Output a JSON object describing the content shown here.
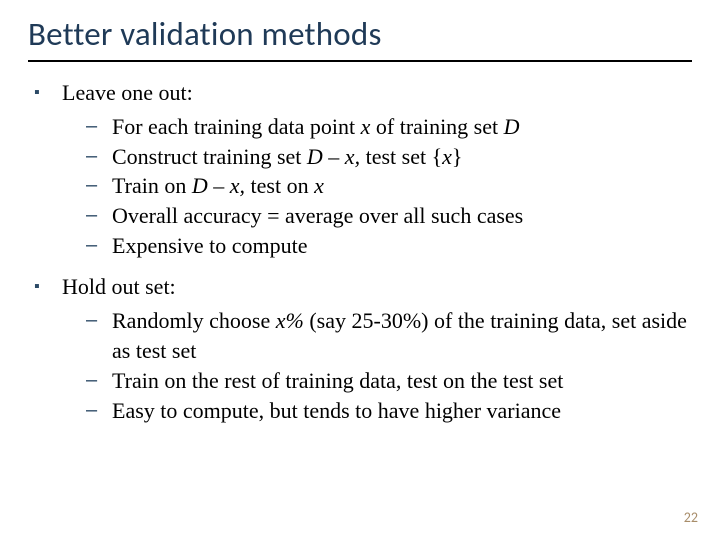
{
  "title": "Better validation methods",
  "sections": [
    {
      "heading": "Leave one out:",
      "items": [
        {
          "pre": "For each training data point ",
          "mid": "x",
          "post": " of training set ",
          "mid2": "D",
          "post2": ""
        },
        {
          "pre": "Construct training set ",
          "mid": "D – x,",
          "post": " test set {",
          "mid2": "x",
          "post2": "}"
        },
        {
          "pre": "Train on ",
          "mid": "D – x,",
          "post": " test on ",
          "mid2": "x",
          "post2": ""
        },
        {
          "pre": "Overall accuracy = average over all such cases",
          "mid": "",
          "post": "",
          "mid2": "",
          "post2": ""
        },
        {
          "pre": "Expensive to compute",
          "mid": "",
          "post": "",
          "mid2": "",
          "post2": ""
        }
      ]
    },
    {
      "heading": "Hold out set:",
      "items": [
        {
          "pre": "Randomly choose ",
          "mid": "x%",
          "post": " (say 25-30%) of the training data, set aside as test set",
          "mid2": "",
          "post2": ""
        },
        {
          "pre": "Train on the rest of training data, test on the test set",
          "mid": "",
          "post": "",
          "mid2": "",
          "post2": ""
        },
        {
          "pre": "Easy to compute, but tends to have higher variance",
          "mid": "",
          "post": "",
          "mid2": "",
          "post2": ""
        }
      ]
    }
  ],
  "page_number": "22",
  "glyphs": {
    "square": "▪",
    "dash": "–"
  }
}
